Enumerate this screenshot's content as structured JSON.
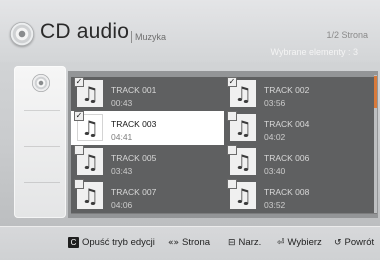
{
  "header": {
    "title": "CD audio",
    "breadcrumb": "Muzyka",
    "page_indicator": "1/2 Strona",
    "selected_indicator": "Wybrane elementy : 3"
  },
  "tracks": [
    {
      "name": "TRACK 001",
      "time": "00:43",
      "checked": true,
      "focused": false
    },
    {
      "name": "TRACK 002",
      "time": "03:56",
      "checked": true,
      "focused": false
    },
    {
      "name": "TRACK 003",
      "time": "04:41",
      "checked": true,
      "focused": true
    },
    {
      "name": "TRACK 004",
      "time": "04:02",
      "checked": false,
      "focused": false
    },
    {
      "name": "TRACK 005",
      "time": "03:43",
      "checked": false,
      "focused": false
    },
    {
      "name": "TRACK 006",
      "time": "03:40",
      "checked": false,
      "focused": false
    },
    {
      "name": "TRACK 007",
      "time": "04:06",
      "checked": false,
      "focused": false
    },
    {
      "name": "TRACK 008",
      "time": "03:52",
      "checked": false,
      "focused": false
    }
  ],
  "check_mark": "✓",
  "music_note_glyph": "♫",
  "footer": {
    "exit_key": "C",
    "exit_label": "Opuść tryb edycji",
    "page_glyph": "«»",
    "page_label": "Strona",
    "tools_glyph": "⊟",
    "tools_label": "Narz.",
    "select_glyph": "⏎",
    "select_label": "Wybierz",
    "return_glyph": "↺",
    "return_label": "Powrót"
  },
  "colors": {
    "focus_bg": "#ffffff",
    "item_bg": "#5f6061",
    "scroll_accent": "#d87a3b"
  }
}
